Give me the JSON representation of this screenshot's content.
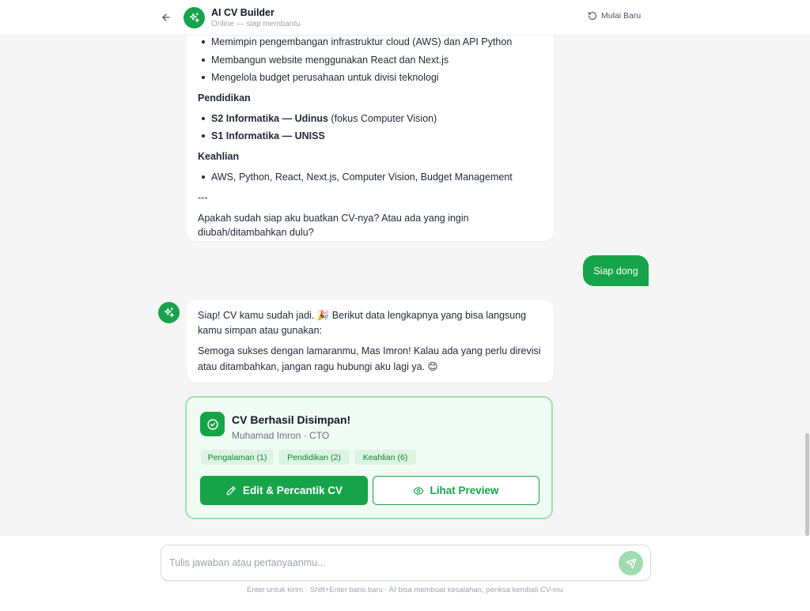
{
  "header": {
    "title": "AI CV Builder",
    "status": "Online — siap membantu",
    "restart_label": "Mulai Baru"
  },
  "message_1": {
    "truncated_line": "Memimpin pengembangan infrastruktur cloud (AWS) dan API Python",
    "bullets_a": [
      "Membangun website menggunakan React dan Next.js",
      "Mengelola budget perusahaan untuk divisi teknologi"
    ],
    "heading_pendidikan": "Pendidikan",
    "edu_1_bold": "S2 Informatika — Udinus",
    "edu_1_rest": " (fokus Computer Vision)",
    "edu_2_bold": "S1 Informatika — UNISS",
    "heading_keahlian": "Keahlian",
    "skills": "AWS, Python, React, Next.js, Computer Vision, Budget Management",
    "separator": "---",
    "question_line_1": "Apakah sudah siap aku buatkan CV-nya? Atau ada yang ingin",
    "question_line_2": "diubah/ditambahkan dulu?"
  },
  "user_message": "Siap dong",
  "message_2": {
    "line_1": "Siap! CV kamu sudah jadi. 🎉 Berikut data lengkapnya yang bisa langsung",
    "line_2": "kamu simpan atau gunakan:",
    "line_3": "Semoga sukses dengan lamaranmu, Mas Imron! Kalau ada yang perlu direvisi",
    "line_4": "atau ditambahkan, jangan ragu hubungi aku lagi ya. 😊"
  },
  "cv_card": {
    "title": "CV Berhasil Disimpan!",
    "subtitle": "Muhamad Imron · CTO",
    "chips": [
      "Pengalaman (1)",
      "Pendidikan (2)",
      "Keahlian (6)"
    ],
    "edit_label": "Edit & Percantik CV",
    "preview_label": "Lihat Preview"
  },
  "composer": {
    "placeholder": "Tulis jawaban atau pertanyaanmu...",
    "value": "",
    "hint": "Enter untuk kirim · Shift+Enter baris baru · AI bisa membuat kesalahan, periksa kembali CV-mu"
  },
  "icons": {
    "back": "arrow-left-icon",
    "brand": "sparkles-icon",
    "restart": "rotate-ccw-icon",
    "cv_check": "circle-check-icon",
    "edit": "pencil-icon",
    "preview": "eye-icon",
    "send": "send-icon"
  },
  "colors": {
    "accent": "#16a34a",
    "card_bg": "#f0fbf3",
    "card_border": "#9fe0b1",
    "chip_bg": "#dcf4e3",
    "send_disabled": "#9fdcb0"
  }
}
